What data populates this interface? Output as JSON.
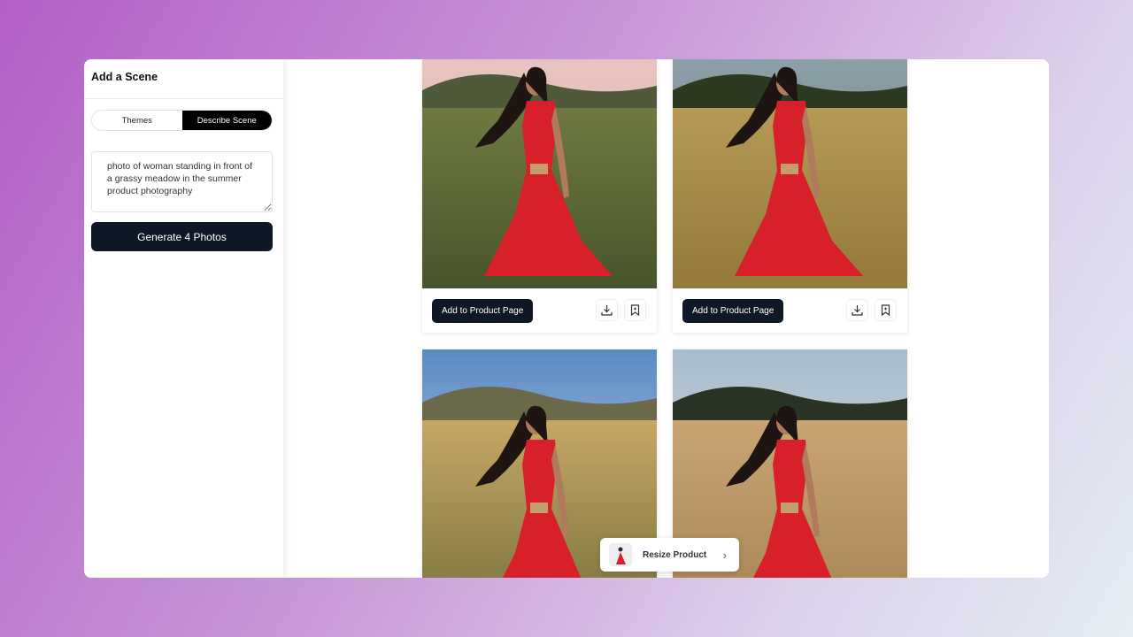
{
  "sidebar": {
    "title": "Add a Scene",
    "tabs": [
      {
        "label": "Themes",
        "active": false
      },
      {
        "label": "Describe Scene",
        "active": true
      }
    ],
    "prompt_value": "photo of woman standing in front of a grassy meadow in the summer product photography",
    "generate_label": "Generate 4 Photos"
  },
  "results": {
    "cards": [
      {
        "add_label": "Add to Product Page",
        "icons": [
          "download-icon",
          "bookmark-icon"
        ]
      },
      {
        "add_label": "Add to Product Page",
        "icons": [
          "download-icon",
          "bookmark-icon"
        ]
      }
    ]
  },
  "resize": {
    "label": "Resize Product",
    "icon": "chevron-right-icon"
  },
  "colors": {
    "accent": "#0d1726",
    "dress": "#d8202a"
  }
}
